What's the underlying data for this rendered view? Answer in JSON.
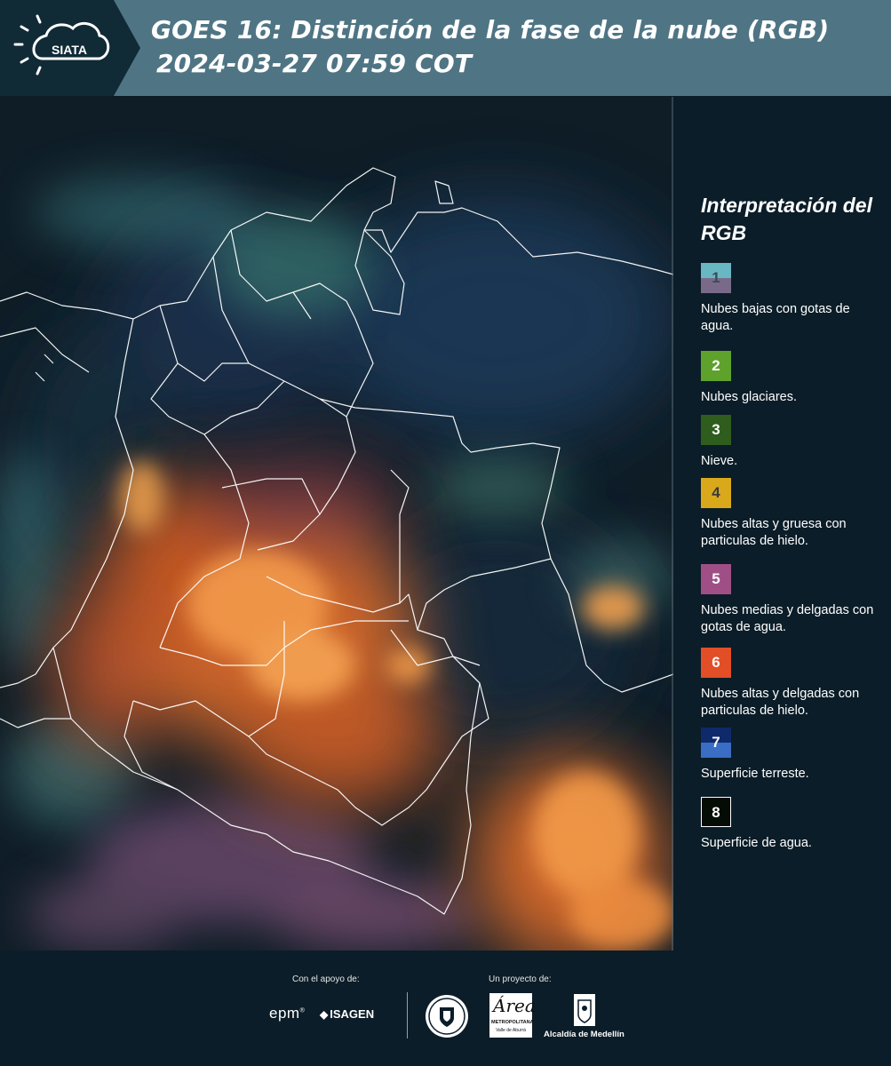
{
  "header": {
    "logo_text": "SIATA",
    "title_line1": "GOES 16: Distinción de la fase de la nube (RGB)",
    "title_line2": "2024-03-27 07:59 COT"
  },
  "legend": {
    "title": "Interpretación del RGB",
    "items": [
      {
        "num": "1",
        "text": "Nubes bajas con gotas de agua.",
        "color_top": "#6ab7c4",
        "color_bottom": "#7a6a8a",
        "num_color": "#3a4a55"
      },
      {
        "num": "2",
        "text": "Nubes glaciares.",
        "color": "#5ea22c",
        "num_color": "#ffffff"
      },
      {
        "num": "3",
        "text": "Nieve.",
        "color": "#2e5d1e",
        "num_color": "#ffffff"
      },
      {
        "num": "4",
        "text": "Nubes altas y gruesa con particulas de hielo.",
        "color": "#d9a91b",
        "num_color": "#3a3a3a"
      },
      {
        "num": "5",
        "text": "Nubes medias y delgadas con gotas de agua.",
        "color": "#a04f86",
        "num_color": "#ffffff"
      },
      {
        "num": "6",
        "text": "Nubes altas y delgadas con particulas de hielo.",
        "color": "#e24e26",
        "num_color": "#ffffff"
      },
      {
        "num": "7",
        "text": "Superficie terreste.",
        "color_top": "#0f2a6b",
        "color_bottom": "#3a6dc4",
        "num_color": "#ffffff"
      },
      {
        "num": "8",
        "text": "Superficie de agua.",
        "color": "#050b05",
        "num_color": "#ffffff",
        "border": "#ffffff"
      }
    ]
  },
  "footer": {
    "support_caption": "Con el apoyo de:",
    "project_caption": "Un proyecto de:",
    "sponsor_epm": "epm",
    "sponsor_isagen": "ISAGEN",
    "area_line1": "Área",
    "area_line2": "METROPOLITANA",
    "area_line3": "Valle de Aburrá",
    "alcaldia": "Alcaldía de Medellín"
  }
}
